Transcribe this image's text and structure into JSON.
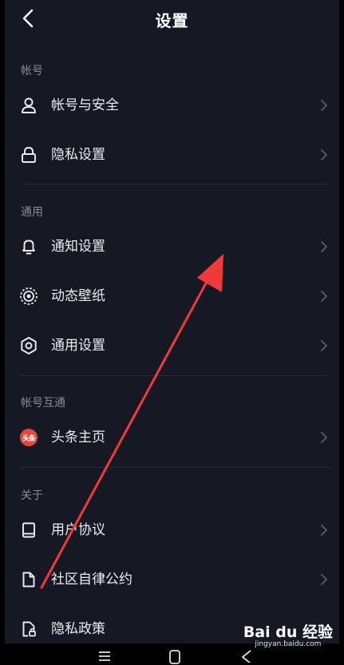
{
  "header": {
    "title": "设置",
    "back_icon": "chevron-left-icon"
  },
  "sections": [
    {
      "label": "帐号",
      "items": [
        {
          "label": "帐号与安全",
          "icon": "user-icon"
        },
        {
          "label": "隐私设置",
          "icon": "lock-icon"
        }
      ]
    },
    {
      "label": "通用",
      "items": [
        {
          "label": "通知设置",
          "icon": "bell-icon"
        },
        {
          "label": "动态壁纸",
          "icon": "live-wallpaper-icon"
        },
        {
          "label": "通用设置",
          "icon": "gear-icon"
        }
      ]
    },
    {
      "label": "帐号互通",
      "items": [
        {
          "label": "头条主页",
          "icon": "toutiao-icon",
          "badge_text": "头条",
          "badge_color": "#E8463C"
        }
      ]
    },
    {
      "label": "关于",
      "items": [
        {
          "label": "用户协议",
          "icon": "book-icon"
        },
        {
          "label": "社区自律公约",
          "icon": "document-icon"
        },
        {
          "label": "隐私政策",
          "icon": "privacy-document-icon"
        }
      ]
    }
  ],
  "nav_bar": {
    "buttons": [
      "menu-icon",
      "home-icon",
      "back-icon"
    ]
  },
  "watermark": {
    "logo": "Bai du 经验",
    "url": "jingyan.baidu.com"
  },
  "colors": {
    "background": "#161823",
    "text": "#ECECF0",
    "section_label": "#8A8B91",
    "divider": "#2A2C36",
    "chevron": "#5C5E66",
    "annotation_arrow": "#F03A3A"
  }
}
